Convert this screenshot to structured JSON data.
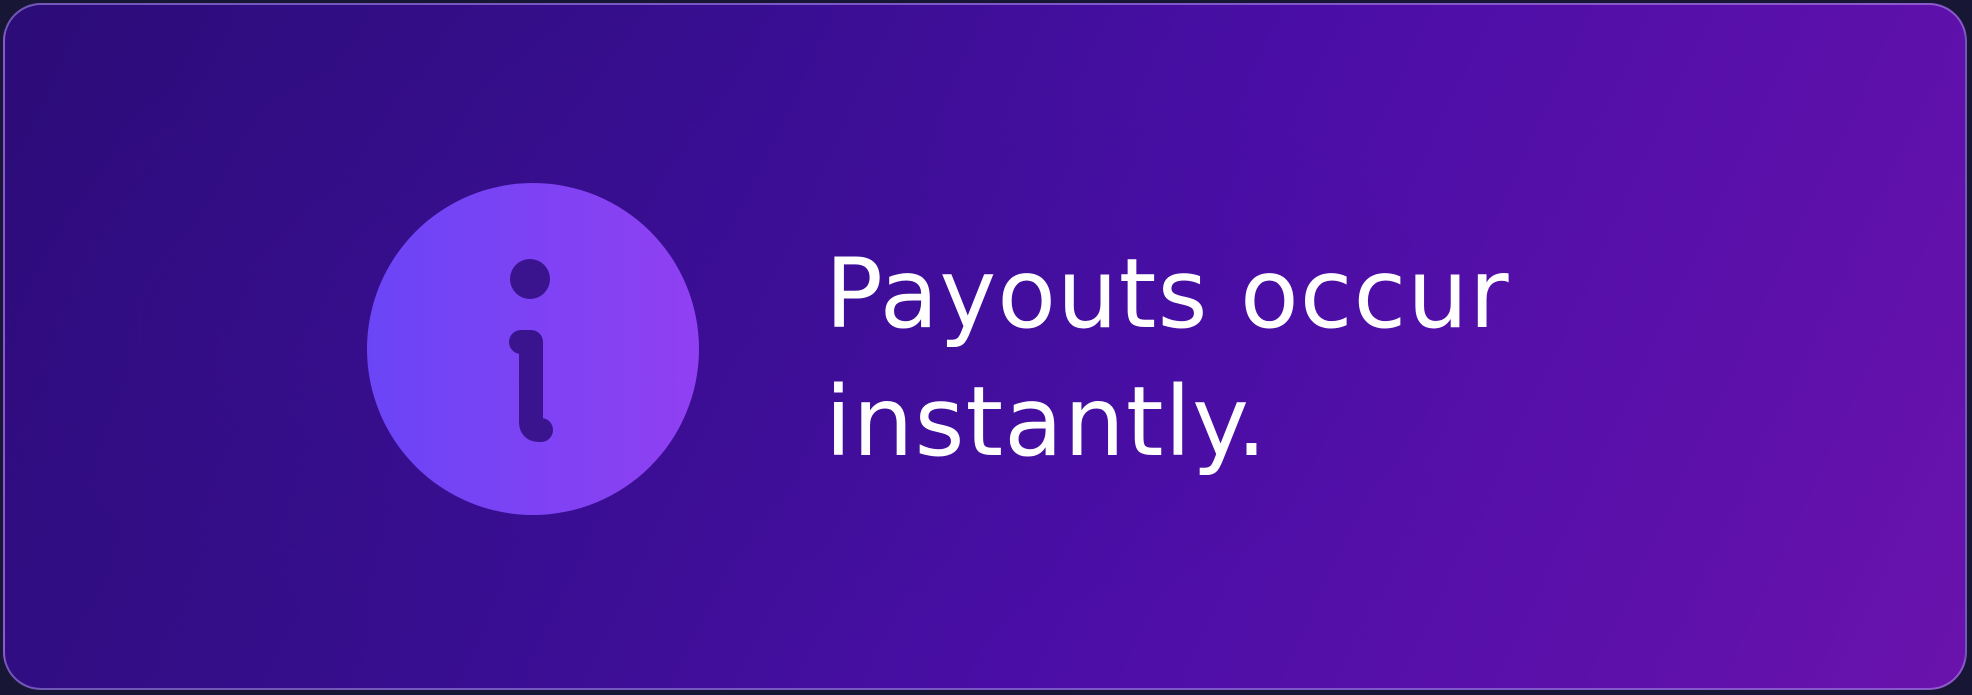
{
  "notice": {
    "message": "Payouts occur instantly.",
    "icon": "info-icon",
    "colors": {
      "icon_gradient_start": "#6a45f6",
      "icon_gradient_end": "#9040f2",
      "icon_glyph": "#3a138f",
      "text": "#ffffff",
      "background_start": "#2c0c78",
      "background_end": "#6a12ac"
    }
  }
}
